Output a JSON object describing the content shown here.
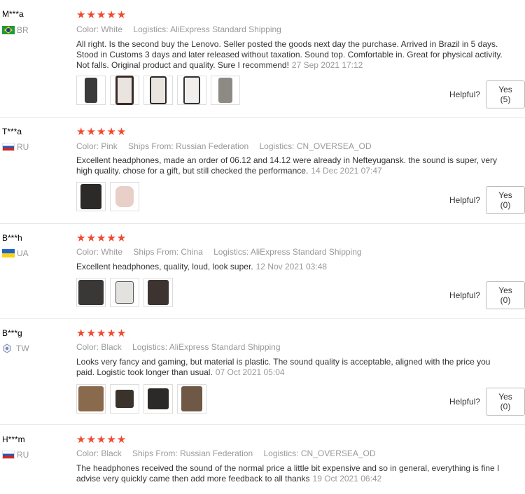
{
  "reviews": [
    {
      "user": "M***a",
      "country": "BR",
      "flag": "brazil-flag-icon",
      "stars": "★★★★★",
      "meta": [
        {
          "k": "Color:",
          "v": "White"
        },
        {
          "k": "Logistics:",
          "v": "AliExpress Standard Shipping"
        }
      ],
      "text": "All right. Is the second buy the Lenovo. Seller posted the goods next day the purchase. Arrived in Brazil in 5 days. Stood in Customs 3 days and later released without taxation. Sound top. Comfortable in. Great for physical activity. Not falls. Original product and quality. Sure I recommend!",
      "date": "27 Sep 2021 17:12",
      "photo_count": 5,
      "helpful_label": "Helpful?",
      "yes_label": "Yes (5)"
    },
    {
      "user": "T***a",
      "country": "RU",
      "flag": "russia-flag-icon",
      "stars": "★★★★★",
      "meta": [
        {
          "k": "Color:",
          "v": "Pink"
        },
        {
          "k": "Ships From:",
          "v": "Russian Federation"
        },
        {
          "k": "Logistics:",
          "v": "CN_OVERSEA_OD"
        }
      ],
      "text": "Excellent headphones, made an order of 06.12 and 14.12 were already in Nefteyugansk. the sound is super, very high quality. chose for a gift, but still checked the performance.",
      "date": "14 Dec 2021 07:47",
      "photo_count": 2,
      "helpful_label": "Helpful?",
      "yes_label": "Yes (0)"
    },
    {
      "user": "B***h",
      "country": "UA",
      "flag": "ukraine-flag-icon",
      "stars": "★★★★★",
      "meta": [
        {
          "k": "Color:",
          "v": "White"
        },
        {
          "k": "Ships From:",
          "v": "China"
        },
        {
          "k": "Logistics:",
          "v": "AliExpress Standard Shipping"
        }
      ],
      "text": "Excellent headphones, quality, loud, look super.",
      "date": "12 Nov 2021 03:48",
      "photo_count": 3,
      "helpful_label": "Helpful?",
      "yes_label": "Yes (0)"
    },
    {
      "user": "B***g",
      "country": "TW",
      "flag": "taiwan-flag-icon",
      "stars": "★★★★★",
      "meta": [
        {
          "k": "Color:",
          "v": "Black"
        },
        {
          "k": "Logistics:",
          "v": "AliExpress Standard Shipping"
        }
      ],
      "text": "Looks very fancy and gaming, but material is plastic. The sound quality is acceptable, aligned with the price you paid. Logistic took longer than usual.",
      "date": "07 Oct 2021 05:04",
      "photo_count": 4,
      "helpful_label": "Helpful?",
      "yes_label": "Yes (0)"
    },
    {
      "user": "H***m",
      "country": "RU",
      "flag": "russia-flag-icon",
      "stars": "★★★★★",
      "meta": [
        {
          "k": "Color:",
          "v": "Black"
        },
        {
          "k": "Ships From:",
          "v": "Russian Federation"
        },
        {
          "k": "Logistics:",
          "v": "CN_OVERSEA_OD"
        }
      ],
      "text": "The headphones received the sound of the normal price a little bit expensive and so in general, everything is fine I advise very quickly came then add more feedback to all thanks",
      "date": "19 Oct 2021 06:42",
      "photo_count": 0
    }
  ],
  "colors": {
    "star": "#f0492e",
    "muted": "#999999",
    "thumb_white": "#e9e4df",
    "thumb_dark": "#2c2a28",
    "thumb_brown": "#8a6a4c"
  }
}
